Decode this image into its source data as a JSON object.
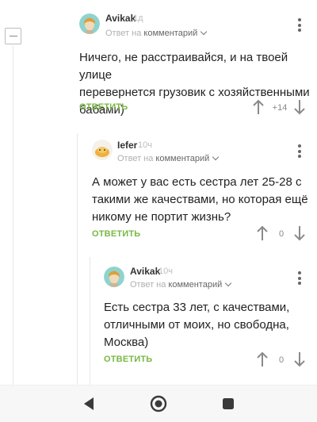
{
  "comments": [
    {
      "author": "Avikak",
      "time": "1д",
      "reply_prefix": "Ответ на",
      "reply_target": "комментарий",
      "text_lines": [
        "Ничего, не расстраивайся, и на твоей улице",
        "перевернется грузовик с хозяйственными",
        "бабами)"
      ],
      "reply_label": "ОТВЕТИТЬ",
      "rating": "+14"
    },
    {
      "author": "Iefer",
      "time": "10ч",
      "reply_prefix": "Ответ на",
      "reply_target": "комментарий",
      "text_lines": [
        "А может у вас есть сестра лет 25-28 с",
        "такими же качествами, но которая ещё",
        "никому не портит жизнь?"
      ],
      "reply_label": "ОТВЕТИТЬ",
      "rating": "0"
    },
    {
      "author": "Avikak",
      "time": "10ч",
      "reply_prefix": "Ответ на",
      "reply_target": "комментарий",
      "text_lines": [
        "Есть сестра 33 лет, с качествами,",
        "отличными от моих, но свободна,",
        "Москва)"
      ],
      "reply_label": "ОТВЕТИТЬ",
      "rating": "0"
    }
  ],
  "icons": {
    "collapse": "minus-square-icon",
    "more": "vertical-dots-icon",
    "upvote": "arrow-up-icon",
    "downvote": "arrow-down-icon",
    "back": "triangle-back-icon",
    "home": "circle-home-icon",
    "recents": "square-recents-icon"
  },
  "colors": {
    "reply": "#79b745",
    "thread_line": "#e6e6e6",
    "meta": "#b0b0b0"
  }
}
